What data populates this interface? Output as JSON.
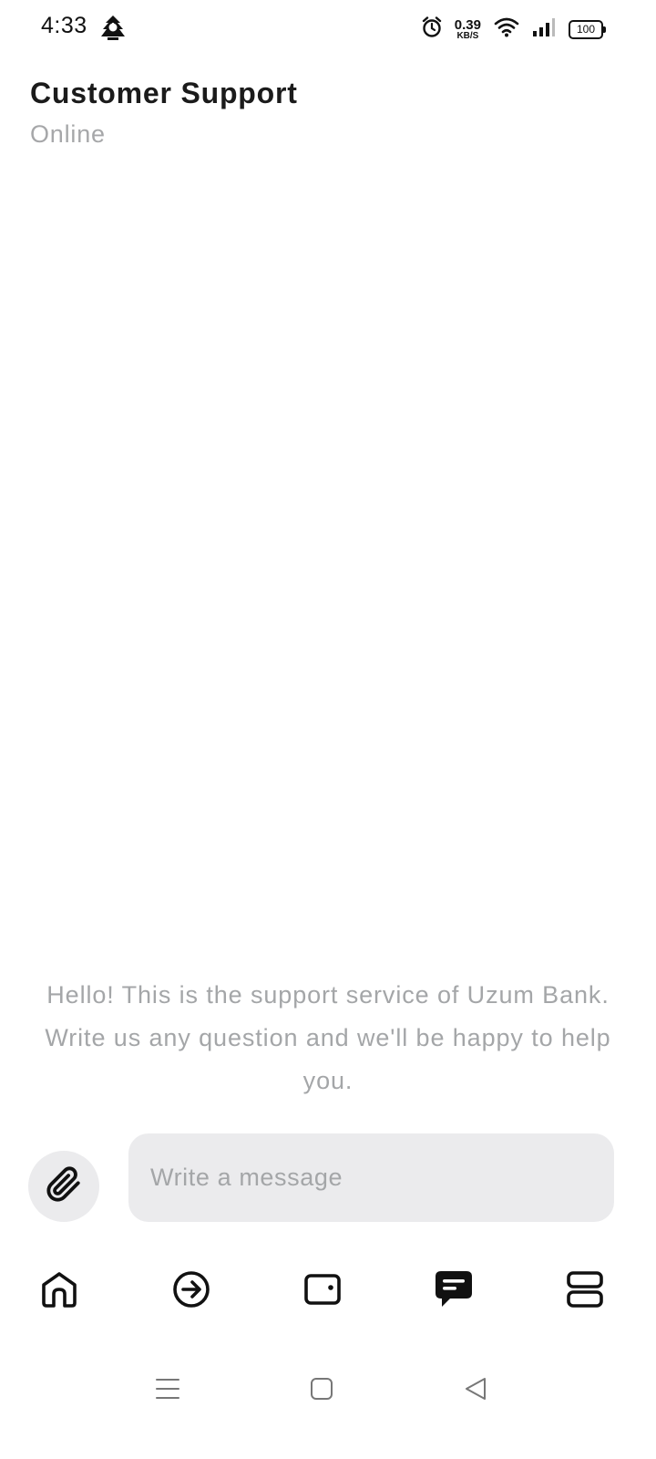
{
  "status_bar": {
    "time": "4:33",
    "net_speed_value": "0.39",
    "net_speed_unit": "KB/S",
    "battery_level": "100",
    "icons": [
      "app-notification-icon",
      "alarm-icon",
      "wifi-icon",
      "signal-icon",
      "battery-icon"
    ]
  },
  "header": {
    "title": "Customer Support",
    "status": "Online"
  },
  "chat": {
    "welcome_message": "Hello! This is the support service of Uzum Bank. Write us any question and we'll be happy to help you."
  },
  "composer": {
    "attach_icon": "paperclip-icon",
    "input_value": "",
    "input_placeholder": "Write a message"
  },
  "bottom_nav": {
    "items": [
      {
        "icon": "home-icon"
      },
      {
        "icon": "transfer-arrow-icon"
      },
      {
        "icon": "wallet-icon"
      },
      {
        "icon": "chat-icon",
        "active": true
      },
      {
        "icon": "services-icon"
      }
    ],
    "active_color": "#111111",
    "inactive_color": "#111111"
  },
  "system_nav": {
    "icons": [
      "menu-icon",
      "home-square-icon",
      "back-icon"
    ]
  },
  "colors": {
    "background": "#ffffff",
    "muted_text": "#a4a6a8",
    "input_bg": "#ebebed",
    "title_text": "#1b1b1b"
  }
}
